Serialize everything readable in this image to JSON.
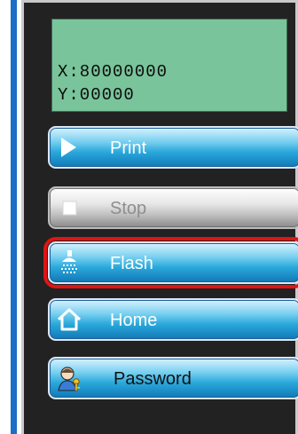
{
  "display": {
    "x_readout": "X:80000000",
    "y_readout": "Y:00000"
  },
  "buttons": {
    "print": "Print",
    "stop": "Stop",
    "flash": "Flash",
    "home": "Home",
    "password": "Password"
  },
  "state": {
    "selected_button": "Flash",
    "disabled_button": "Stop"
  },
  "colors": {
    "display_bg": "#79c49b",
    "panel_bg": "#222222",
    "button_blue": "#2aa8db",
    "selection": "#e01414",
    "accent_strip": "#1b6fc4"
  },
  "icons": {
    "print": "play-triangle-icon",
    "stop": "stop-square-icon",
    "flash": "shower-icon",
    "home": "house-icon",
    "password": "user-key-icon"
  }
}
